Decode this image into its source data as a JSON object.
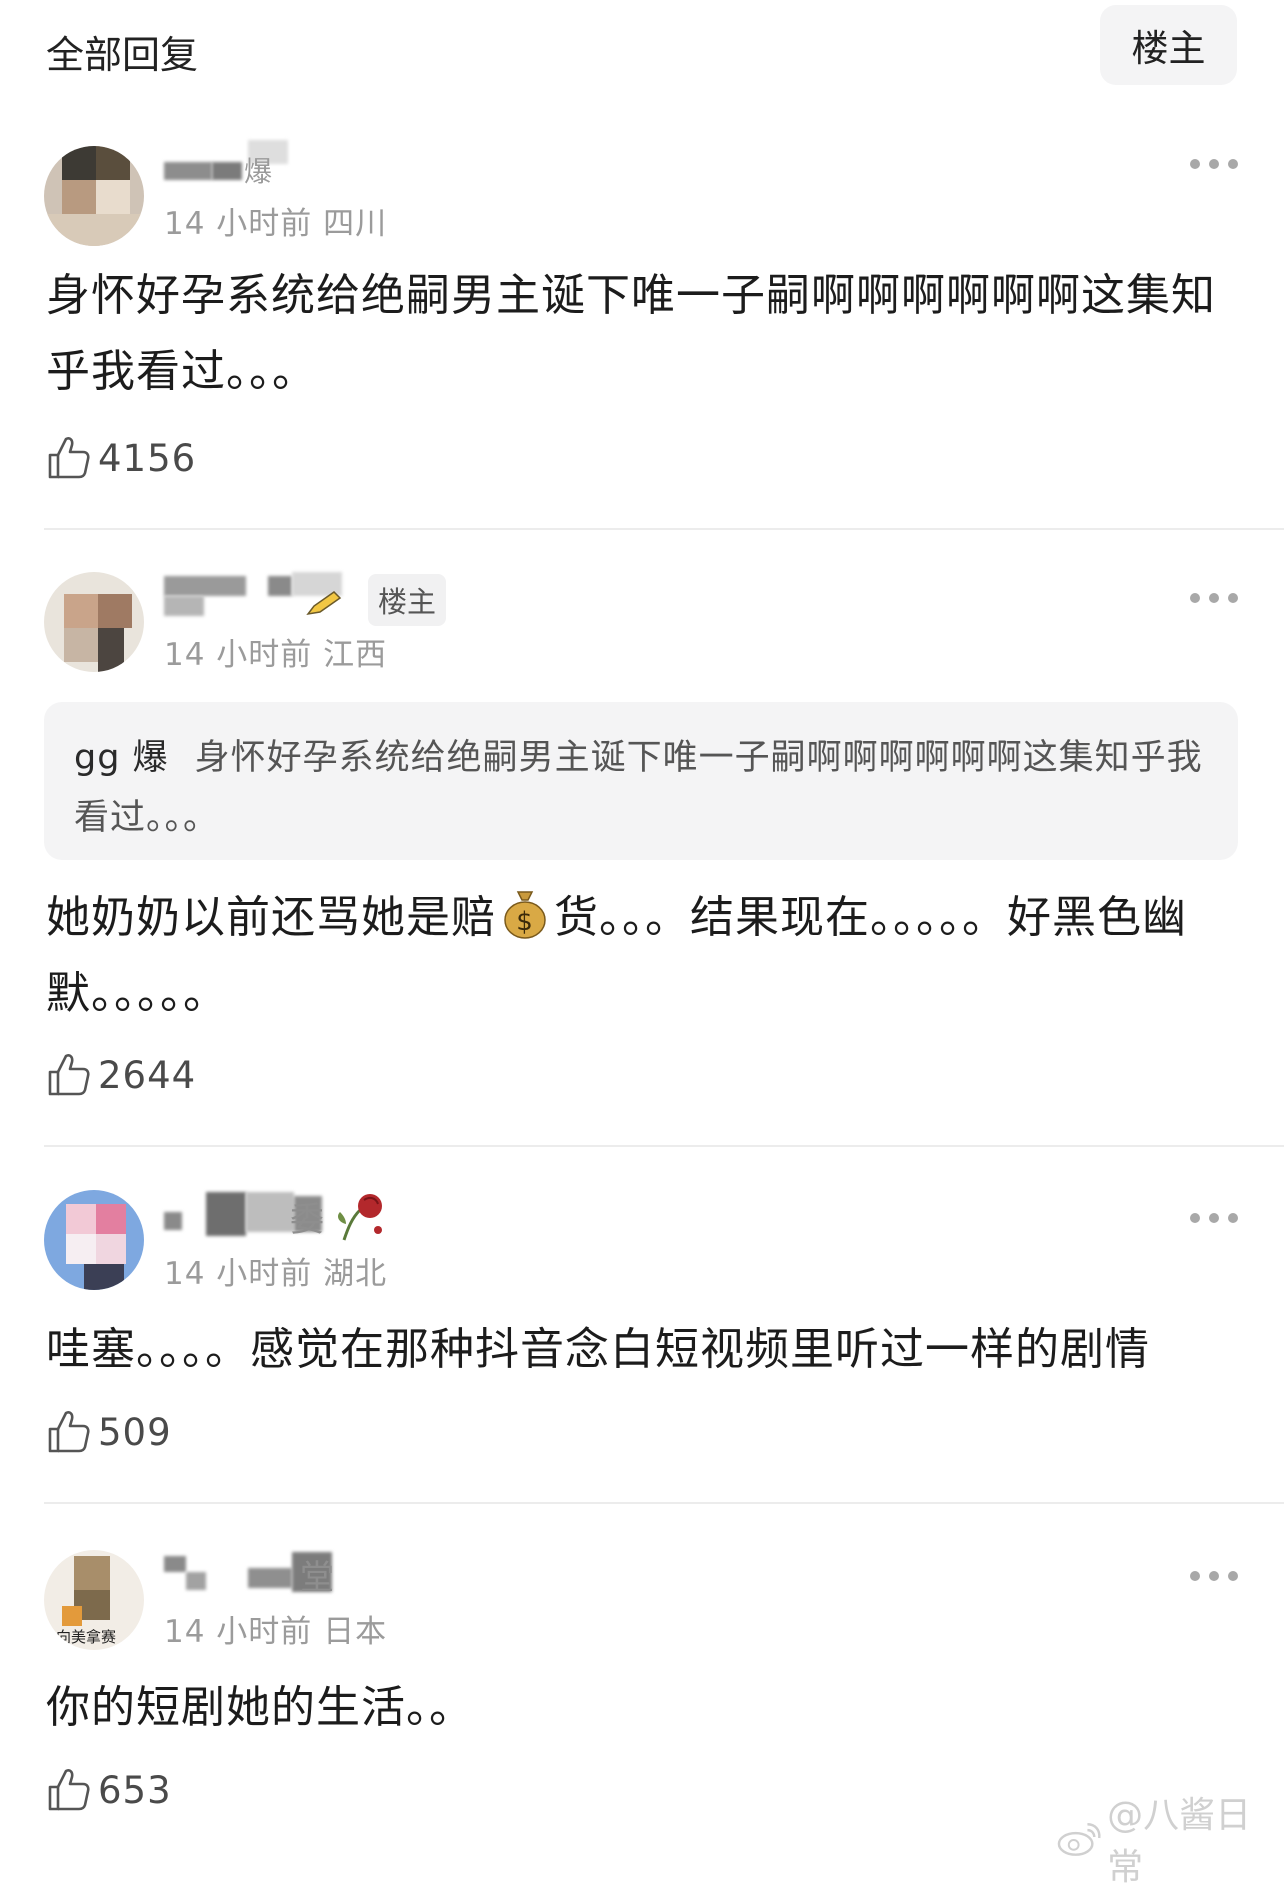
{
  "header": {
    "title": "全部回复",
    "op_tab": "楼主"
  },
  "comments": [
    {
      "username_partial": "爆",
      "meta": "14 小时前 四川",
      "content": "身怀好孕系统给绝嗣男主诞下唯一子嗣啊啊啊啊啊啊这集知乎我看过。。。",
      "likes": "4156"
    },
    {
      "badge": "楼主",
      "meta": "14 小时前 江西",
      "quote": {
        "author": "gg 爆",
        "text": "身怀好孕系统给绝嗣男主诞下唯一子嗣啊啊啊啊啊啊这集知乎我看过。。。"
      },
      "content_before": "她奶奶以前还骂她是赔",
      "content_after": "货。。。结果现在。。。。。好黑色幽默。。。。。",
      "likes": "2644"
    },
    {
      "username_partial": "委",
      "meta": "14 小时前 湖北",
      "content": "哇塞。。。。感觉在那种抖音念白短视频里听过一样的剧情",
      "likes": "509"
    },
    {
      "username_partial": "堂",
      "avatar_text": "向美拿赛",
      "meta": "14 小时前 日本",
      "content": "你的短剧她的生活。。",
      "likes": "653"
    }
  ],
  "watermark": "@八酱日常",
  "icons": {
    "like": "thumbs-up-icon",
    "more": "more-dots-icon",
    "money": "money-bag-icon",
    "rose": "wilted-rose-icon",
    "weibo": "weibo-logo-icon"
  },
  "colors": {
    "meta": "#9b9b9b",
    "divider": "#ececec",
    "quote_bg": "#f4f4f5",
    "icon": "#a8a8a8"
  }
}
